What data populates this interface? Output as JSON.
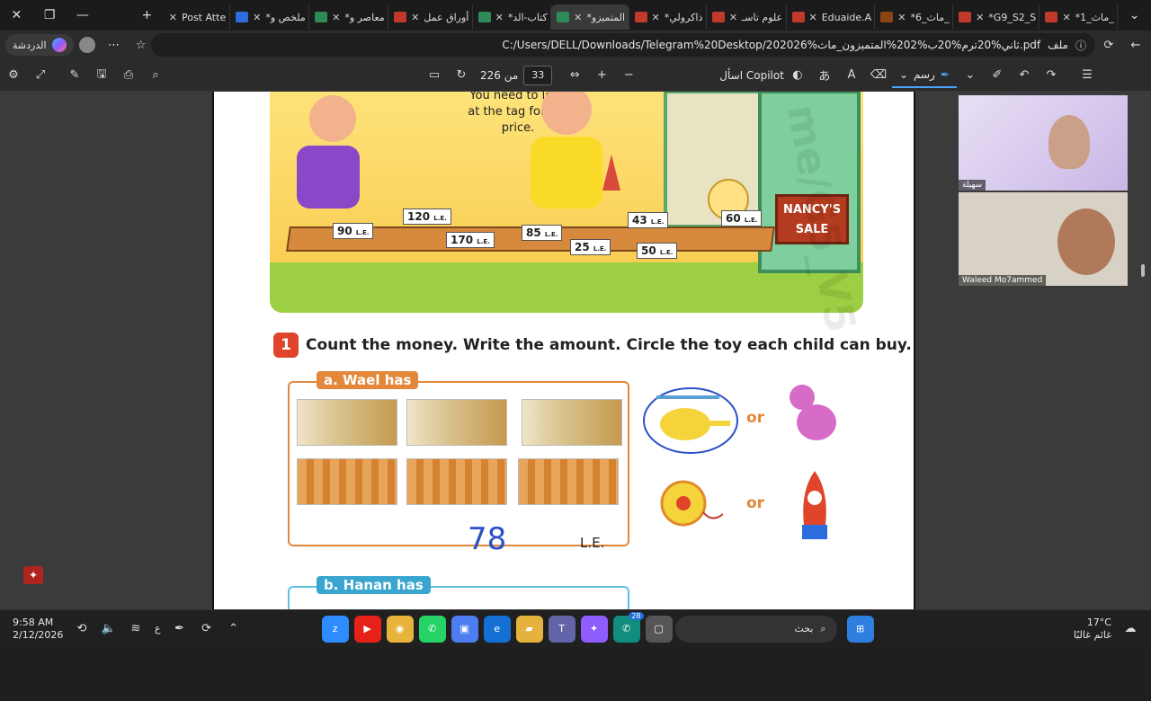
{
  "tabs": [
    {
      "label": "*ماث_1_"
    },
    {
      "label": "*G9_S2_S"
    },
    {
      "label": "*ماث_6_"
    },
    {
      "label": "Eduaide.A"
    },
    {
      "label": "علوم تاسـ"
    },
    {
      "label": "*ذاكرولي"
    },
    {
      "label": "*المتميزو",
      "active": true
    },
    {
      "label": "*كتاب-الد"
    },
    {
      "label": "أوراق عمل"
    },
    {
      "label": "*معاصر و"
    },
    {
      "label": "*ملخص و"
    },
    {
      "label": "Post Atte"
    }
  ],
  "address": {
    "chat_label": "الدردشة",
    "file_label": "ملف",
    "url": "C:/Users/DELL/Downloads/Telegram%20Desktop/202026%ثاني%20ترم%20ب%202%المتميزون_ماث.pdf"
  },
  "pdf_toolbar": {
    "page_current": "33",
    "page_of": "من 226",
    "copilot_label": "اسأل Copilot",
    "draw_label": "رسم"
  },
  "page": {
    "tag_note": "You need to look at the tag for the price.",
    "sale_sign": "NANCY'S SALE",
    "prices": [
      "90",
      "120",
      "170",
      "85",
      "25",
      "43",
      "50",
      "60"
    ],
    "price_unit": "L.E.",
    "exercise_number": "1",
    "exercise_text": "Count the money. Write the amount. Circle the toy each child can buy.",
    "section_a_label": "a. Wael has",
    "section_b_label": "b. Hanan has",
    "written_amount": "78",
    "currency": "L.E.",
    "or_word": "or",
    "watermark": "me/G5_V5"
  },
  "participants": [
    {
      "name": "سهيلة"
    },
    {
      "name": "Waleed Mo7ammed"
    }
  ],
  "taskbar": {
    "time": "9:58 AM",
    "date": "2/12/2026",
    "search_placeholder": "بحث",
    "temperature": "17°C",
    "weather": "غائم غالبًا",
    "language": "ع",
    "badge_count": "28"
  },
  "colors": {
    "accent": "#4aa3ff",
    "orange": "#e3873b",
    "exercise_red": "#e0442a",
    "ink_blue": "#2b4fc8"
  }
}
